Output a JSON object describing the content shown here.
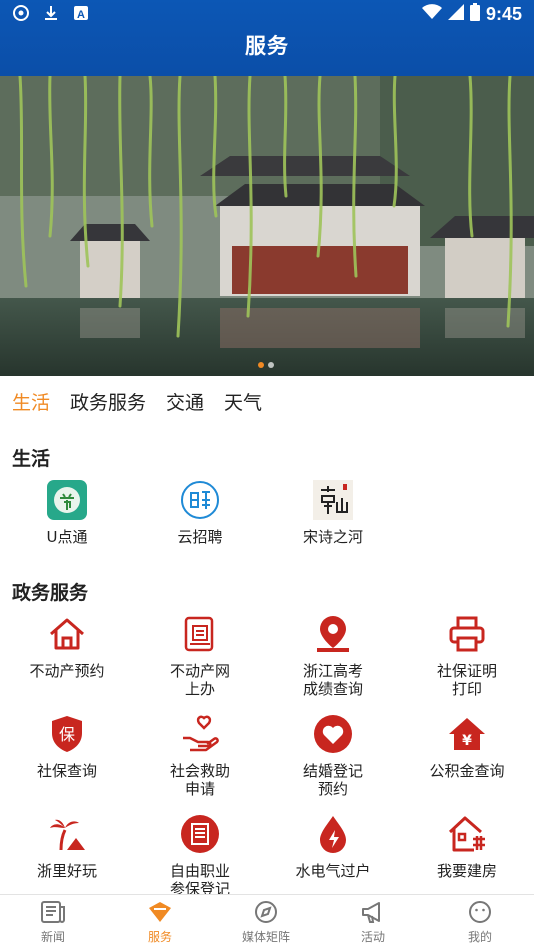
{
  "status_bar": {
    "time": "9:45"
  },
  "header": {
    "title": "服务"
  },
  "banner": {
    "slide_count": 2,
    "active_slide": 1
  },
  "tabs": [
    {
      "label": "生活",
      "active": true
    },
    {
      "label": "政务服务",
      "active": false
    },
    {
      "label": "交通",
      "active": false
    },
    {
      "label": "天气",
      "active": false
    }
  ],
  "life": {
    "title": "生活",
    "items": [
      {
        "label": "U点通",
        "icon": "u-diantong-app-icon"
      },
      {
        "label": "云招聘",
        "icon": "recruit-icon"
      },
      {
        "label": "宋诗之河",
        "icon": "song-poetry-icon"
      }
    ]
  },
  "gov": {
    "title": "政务服务",
    "items": [
      {
        "line1": "不动产预约",
        "line2": "",
        "icon": "house-icon"
      },
      {
        "line1": "不动产网",
        "line2": "上办",
        "icon": "document-icon"
      },
      {
        "line1": "浙江高考",
        "line2": "成绩查询",
        "icon": "location-pin-icon"
      },
      {
        "line1": "社保证明",
        "line2": "打印",
        "icon": "printer-icon"
      },
      {
        "line1": "社保查询",
        "line2": "",
        "icon": "insurance-shield-icon"
      },
      {
        "line1": "社会救助",
        "line2": "申请",
        "icon": "helping-hand-icon"
      },
      {
        "line1": "结婚登记",
        "line2": "预约",
        "icon": "heart-icon"
      },
      {
        "line1": "公积金查询",
        "line2": "",
        "icon": "yuan-house-icon"
      },
      {
        "line1": "浙里好玩",
        "line2": "",
        "icon": "palm-tree-icon"
      },
      {
        "line1": "自由职业",
        "line2": "参保登记",
        "icon": "register-icon"
      },
      {
        "line1": "水电气过户",
        "line2": "",
        "icon": "utility-drop-icon"
      },
      {
        "line1": "我要建房",
        "line2": "",
        "icon": "build-house-icon"
      }
    ]
  },
  "bottom_nav": [
    {
      "label": "新闻",
      "icon": "news-icon",
      "active": false
    },
    {
      "label": "服务",
      "icon": "service-icon",
      "active": true
    },
    {
      "label": "媒体矩阵",
      "icon": "compass-icon",
      "active": false
    },
    {
      "label": "活动",
      "icon": "megaphone-icon",
      "active": false
    },
    {
      "label": "我的",
      "icon": "profile-icon",
      "active": false
    }
  ],
  "colors": {
    "brand_blue": "#0c57b5",
    "accent_orange": "#f08a24",
    "icon_red": "#c8261f"
  }
}
